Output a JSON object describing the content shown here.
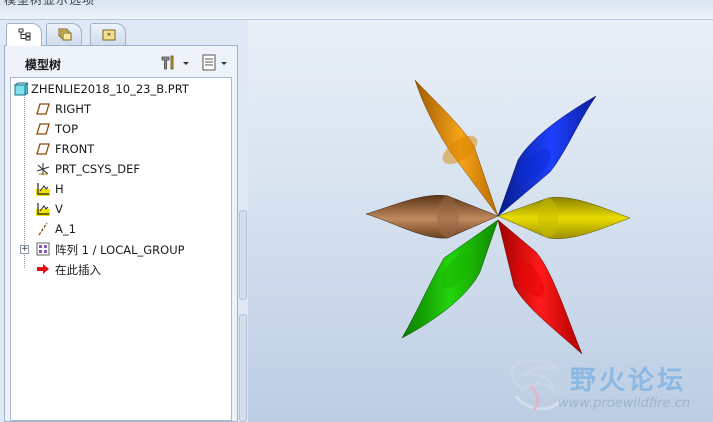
{
  "window": {
    "title": "模型树显示选项"
  },
  "tabs": [
    {
      "name": "model-tree",
      "icon": "model-tree-icon",
      "active": true
    },
    {
      "name": "folder-browser",
      "icon": "folder-icon",
      "active": false
    },
    {
      "name": "favorites",
      "icon": "favorites-icon",
      "active": false
    }
  ],
  "panel": {
    "title": "模型树",
    "settings_icon": "tools-settings-icon",
    "show_icon": "show-list-icon"
  },
  "tree": {
    "root": {
      "label": "ZHENLIE2018_10_23_B.PRT",
      "icon": "part-icon"
    },
    "items": [
      {
        "label": "RIGHT",
        "icon": "datum-plane-icon"
      },
      {
        "label": "TOP",
        "icon": "datum-plane-icon"
      },
      {
        "label": "FRONT",
        "icon": "datum-plane-icon"
      },
      {
        "label": "PRT_CSYS_DEF",
        "icon": "csys-icon"
      },
      {
        "label": "H",
        "icon": "sketch-icon"
      },
      {
        "label": "V",
        "icon": "sketch-icon"
      },
      {
        "label": "A_1",
        "icon": "axis-icon"
      },
      {
        "label": "阵列 1 / LOCAL_GROUP",
        "icon": "pattern-icon"
      },
      {
        "label": "在此插入",
        "icon": "insert-here-arrow-icon"
      }
    ]
  },
  "model": {
    "petal_colors": [
      "#e88a00",
      "#0a2ad8",
      "#d4c800",
      "#e80000",
      "#1ab300",
      "#9a6a45"
    ]
  },
  "watermark": {
    "title": "野火论坛",
    "url": "www.proewildfire.cn"
  }
}
